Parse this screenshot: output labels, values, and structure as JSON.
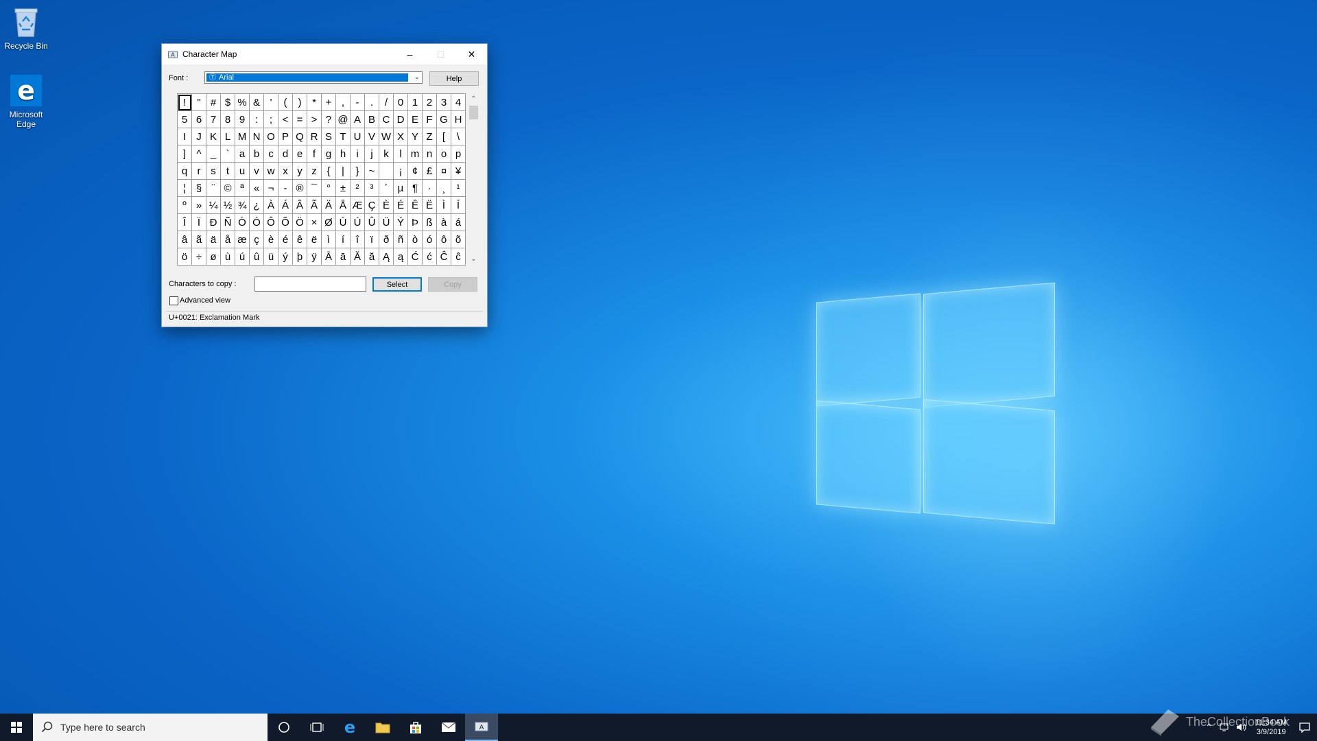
{
  "desktop": {
    "icons": [
      {
        "label": "Recycle Bin"
      },
      {
        "label": "Microsoft Edge"
      }
    ]
  },
  "window": {
    "title": "Character Map",
    "font_label": "Font :",
    "font_value": "Arial",
    "help_label": "Help",
    "chars_to_copy_label": "Characters to copy :",
    "chars_to_copy_value": "",
    "select_label": "Select",
    "copy_label": "Copy",
    "advanced_view_label": "Advanced view",
    "advanced_view_checked": false,
    "status_text": "U+0021: Exclamation Mark",
    "selected_index": 0,
    "grid_rows": [
      [
        "!",
        "\"",
        "#",
        "$",
        "%",
        "&",
        "'",
        "(",
        ")",
        "*",
        "+",
        ",",
        "-",
        ".",
        "/",
        "0",
        "1",
        "2",
        "3",
        "4"
      ],
      [
        "5",
        "6",
        "7",
        "8",
        "9",
        ":",
        ";",
        "<",
        "=",
        ">",
        "?",
        "@",
        "A",
        "B",
        "C",
        "D",
        "E",
        "F",
        "G",
        "H"
      ],
      [
        "I",
        "J",
        "K",
        "L",
        "M",
        "N",
        "O",
        "P",
        "Q",
        "R",
        "S",
        "T",
        "U",
        "V",
        "W",
        "X",
        "Y",
        "Z",
        "[",
        "\\"
      ],
      [
        "]",
        "^",
        "_",
        "`",
        "a",
        "b",
        "c",
        "d",
        "e",
        "f",
        "g",
        "h",
        "i",
        "j",
        "k",
        "l",
        "m",
        "n",
        "o",
        "p"
      ],
      [
        "q",
        "r",
        "s",
        "t",
        "u",
        "v",
        "w",
        "x",
        "y",
        "z",
        "{",
        "|",
        "}",
        "~",
        " ",
        "¡",
        "¢",
        "£",
        "¤",
        "¥"
      ],
      [
        "¦",
        "§",
        "¨",
        "©",
        "ª",
        "«",
        "¬",
        "-",
        "®",
        "¯",
        "°",
        "±",
        "²",
        "³",
        "´",
        "µ",
        "¶",
        "·",
        "¸",
        "¹"
      ],
      [
        "º",
        "»",
        "¼",
        "½",
        "¾",
        "¿",
        "À",
        "Á",
        "Â",
        "Ã",
        "Ä",
        "Å",
        "Æ",
        "Ç",
        "È",
        "É",
        "Ê",
        "Ë",
        "Ì",
        "Í"
      ],
      [
        "Î",
        "Ï",
        "Ð",
        "Ñ",
        "Ò",
        "Ó",
        "Ô",
        "Õ",
        "Ö",
        "×",
        "Ø",
        "Ù",
        "Ú",
        "Û",
        "Ü",
        "Ý",
        "Þ",
        "ß",
        "à",
        "á"
      ],
      [
        "â",
        "ã",
        "ä",
        "å",
        "æ",
        "ç",
        "è",
        "é",
        "ê",
        "ë",
        "ì",
        "í",
        "î",
        "ï",
        "ð",
        "ñ",
        "ò",
        "ó",
        "ô",
        "õ"
      ],
      [
        "ö",
        "÷",
        "ø",
        "ù",
        "ú",
        "û",
        "ü",
        "ý",
        "þ",
        "ÿ",
        "Ā",
        "ā",
        "Ă",
        "ă",
        "Ą",
        "ą",
        "Ć",
        "ć",
        "Ĉ",
        "ĉ"
      ]
    ]
  },
  "taskbar": {
    "search_placeholder": "Type here to search",
    "clock_time": "11:34 AM",
    "clock_date": "3/9/2019"
  },
  "watermark": {
    "text": "TheCollectionBook"
  },
  "colors": {
    "accent": "#0078d7",
    "taskbar": "#101a2a"
  }
}
